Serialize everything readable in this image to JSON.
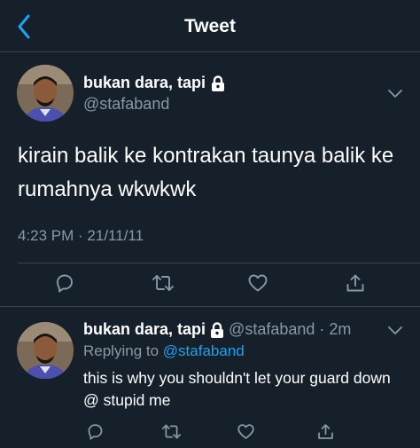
{
  "header": {
    "title": "Tweet",
    "back_icon": "chevron-left-icon"
  },
  "main_tweet": {
    "display_name": "bukan dara, tapi",
    "handle": "@stafaband",
    "text": "kirain balik ke kontrakan taunya balik ke rumahnya wkwkwk",
    "timestamp": "4:23 PM · 21/11/11",
    "actions": [
      "reply-icon",
      "retweet-icon",
      "like-icon",
      "share-icon"
    ]
  },
  "reply_tweet": {
    "display_name": "bukan dara, tapi",
    "handle": "@stafaband",
    "separator": "·",
    "time": "2m",
    "replying_prefix": "Replying to",
    "replying_to": "@stafaband",
    "text": "this is why you shouldn't let your guard down @ stupid me"
  },
  "colors": {
    "background": "#15202b",
    "secondary_text": "#8899a6",
    "accent": "#1da1f2",
    "divider": "#38444d"
  }
}
